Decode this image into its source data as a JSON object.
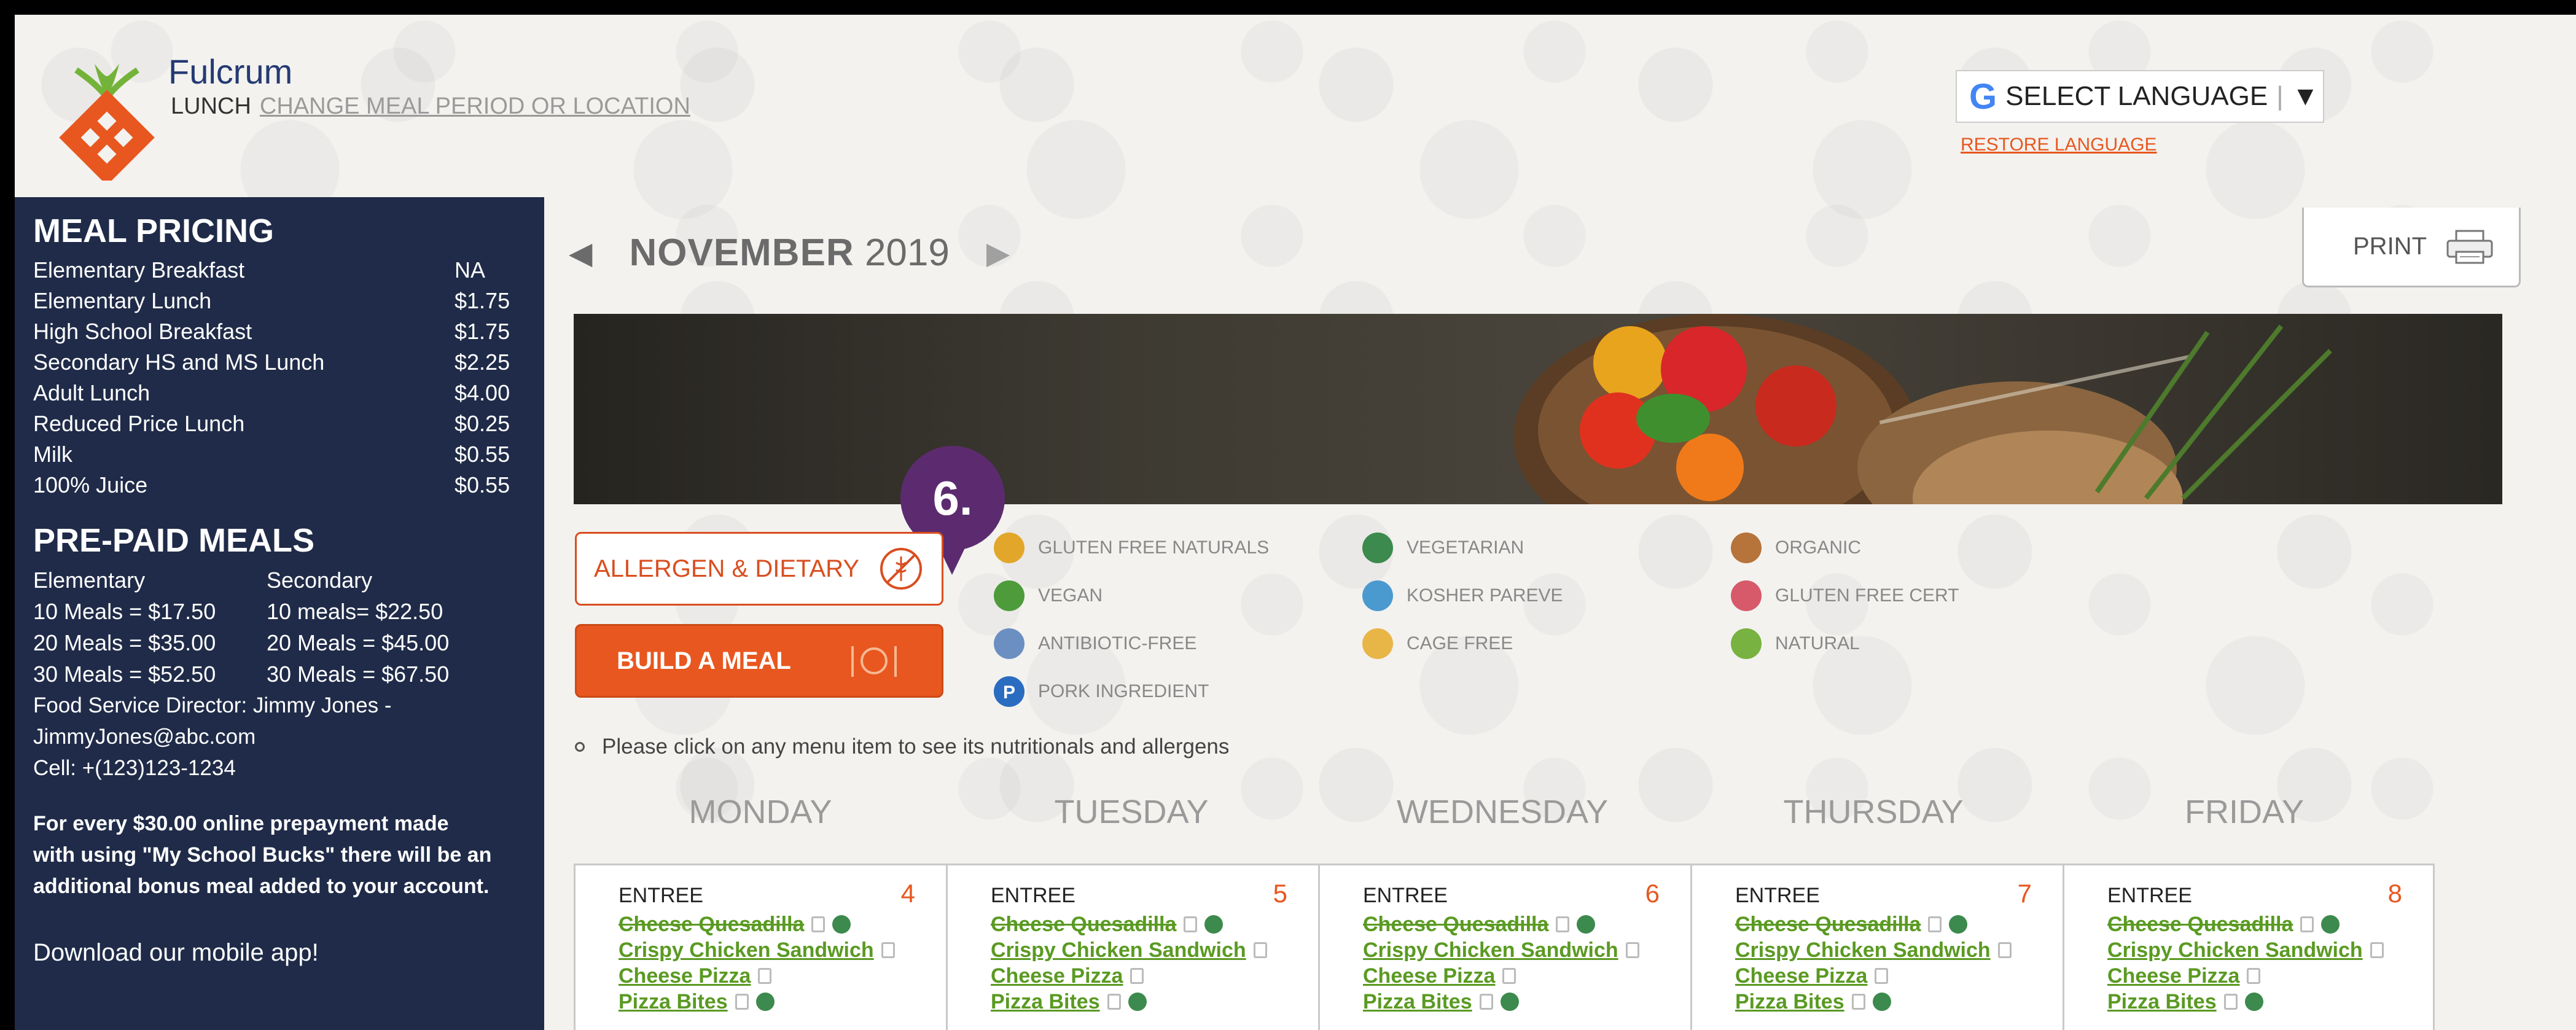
{
  "header": {
    "brand": "Fulcrum",
    "meal_period": "LUNCH",
    "change_link": "CHANGE MEAL PERIOD OR LOCATION",
    "language_label": "SELECT LANGUAGE",
    "language_dropdown_glyph": "▼",
    "google_glyph": "G",
    "restore_language": "RESTORE LANGUAGE"
  },
  "sidebar": {
    "pricing_title": "MEAL PRICING",
    "prices": [
      {
        "name": "Elementary Breakfast",
        "value": "NA"
      },
      {
        "name": "Elementary Lunch",
        "value": "$1.75"
      },
      {
        "name": "High School Breakfast",
        "value": "$1.75"
      },
      {
        "name": "Secondary HS and MS Lunch",
        "value": "$2.25"
      },
      {
        "name": "Adult Lunch",
        "value": "$4.00"
      },
      {
        "name": "Reduced Price Lunch",
        "value": "$0.25"
      },
      {
        "name": "Milk",
        "value": "$0.55"
      },
      {
        "name": "100% Juice",
        "value": "$0.55"
      }
    ],
    "prepaid_title": "PRE-PAID MEALS",
    "prepaid_headers": [
      "Elementary",
      "Secondary"
    ],
    "prepaid_rows": [
      [
        "10 Meals = $17.50",
        "10 meals= $22.50"
      ],
      [
        "20 Meals = $35.00",
        "20 Meals = $45.00"
      ],
      [
        "30 Meals = $52.50",
        "30 Meals = $67.50"
      ]
    ],
    "director_line": "Food Service Director: Jimmy Jones -",
    "director_email": "JimmyJones@abc.com",
    "director_cell": "Cell: +(123)123-1234",
    "bonus_text_1": "For every $30.00 online prepayment made",
    "bonus_text_2": "with using \"My School Bucks\" there will be an",
    "bonus_text_3": "additional bonus meal added to your account.",
    "app_text": "Download our mobile app!"
  },
  "main": {
    "prev_glyph": "◀",
    "next_glyph": "▶",
    "month": "NOVEMBER",
    "year": "2019",
    "print_label": "PRINT",
    "step_badge": "6.",
    "allergen_button": "ALLERGEN & DIETARY",
    "build_button": "BUILD A MEAL",
    "legend": [
      {
        "label": "GLUTEN FREE NATURALS",
        "color": "#e2a72a"
      },
      {
        "label": "VEGETARIAN",
        "color": "#3c8a4d"
      },
      {
        "label": "ORGANIC",
        "color": "#b6733a"
      },
      {
        "label": "VEGAN",
        "color": "#4e9b3c"
      },
      {
        "label": "KOSHER PAREVE",
        "color": "#4a9ad0"
      },
      {
        "label": "GLUTEN FREE CERT",
        "color": "#d75a6a"
      },
      {
        "label": "ANTIBIOTIC-FREE",
        "color": "#6c8fc2"
      },
      {
        "label": "CAGE FREE",
        "color": "#e8b547"
      },
      {
        "label": "NATURAL",
        "color": "#78b240"
      },
      {
        "label": "PORK INGREDIENT",
        "color": "#2a6cc0"
      }
    ],
    "hint": "Please click on any menu item to see its nutritionals and allergens",
    "days": [
      "MONDAY",
      "TUESDAY",
      "WEDNESDAY",
      "THURSDAY",
      "FRIDAY"
    ],
    "calendar": [
      {
        "date": "4",
        "label": "ENTREE",
        "items": [
          "Cheese Quesadilla",
          "Crispy Chicken Sandwich",
          "Cheese Pizza",
          "Pizza Bites"
        ]
      },
      {
        "date": "5",
        "label": "ENTREE",
        "items": [
          "Cheese Quesadilla",
          "Crispy Chicken Sandwich",
          "Cheese Pizza",
          "Pizza Bites"
        ]
      },
      {
        "date": "6",
        "label": "ENTREE",
        "items": [
          "Cheese Quesadilla",
          "Crispy Chicken Sandwich",
          "Cheese Pizza",
          "Pizza Bites"
        ]
      },
      {
        "date": "7",
        "label": "ENTREE",
        "items": [
          "Cheese Quesadilla",
          "Crispy Chicken Sandwich",
          "Cheese Pizza",
          "Pizza Bites"
        ]
      },
      {
        "date": "8",
        "label": "ENTREE",
        "items": [
          "Cheese Quesadilla",
          "Crispy Chicken Sandwich",
          "Cheese Pizza",
          "Pizza Bites"
        ]
      }
    ]
  }
}
